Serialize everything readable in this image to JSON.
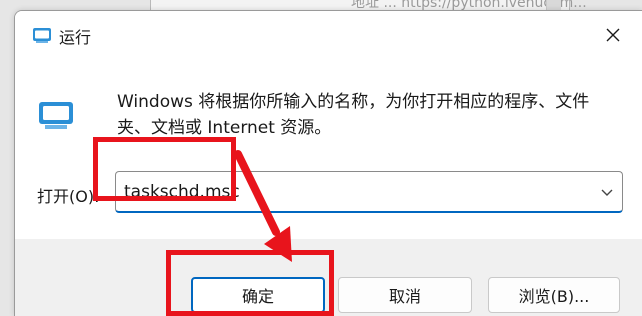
{
  "background": {
    "text": "地址 ... https://python.ivenucom..."
  },
  "dialog": {
    "title": "运行",
    "description": "Windows 将根据你所输入的名称，为你打开相应的程序、文件夹、文档或 Internet 资源。",
    "open_label": "打开(O):",
    "command_value": "taskschd.msc",
    "buttons": {
      "ok": "确定",
      "cancel": "取消",
      "browse": "浏览(B)..."
    }
  },
  "icons": {
    "title": "run-app-icon",
    "close": "close-icon",
    "big": "run-app-icon",
    "dropdown": "chevron-down-icon"
  },
  "colors": {
    "accent": "#0067c0",
    "annotation": "#e8141c"
  }
}
